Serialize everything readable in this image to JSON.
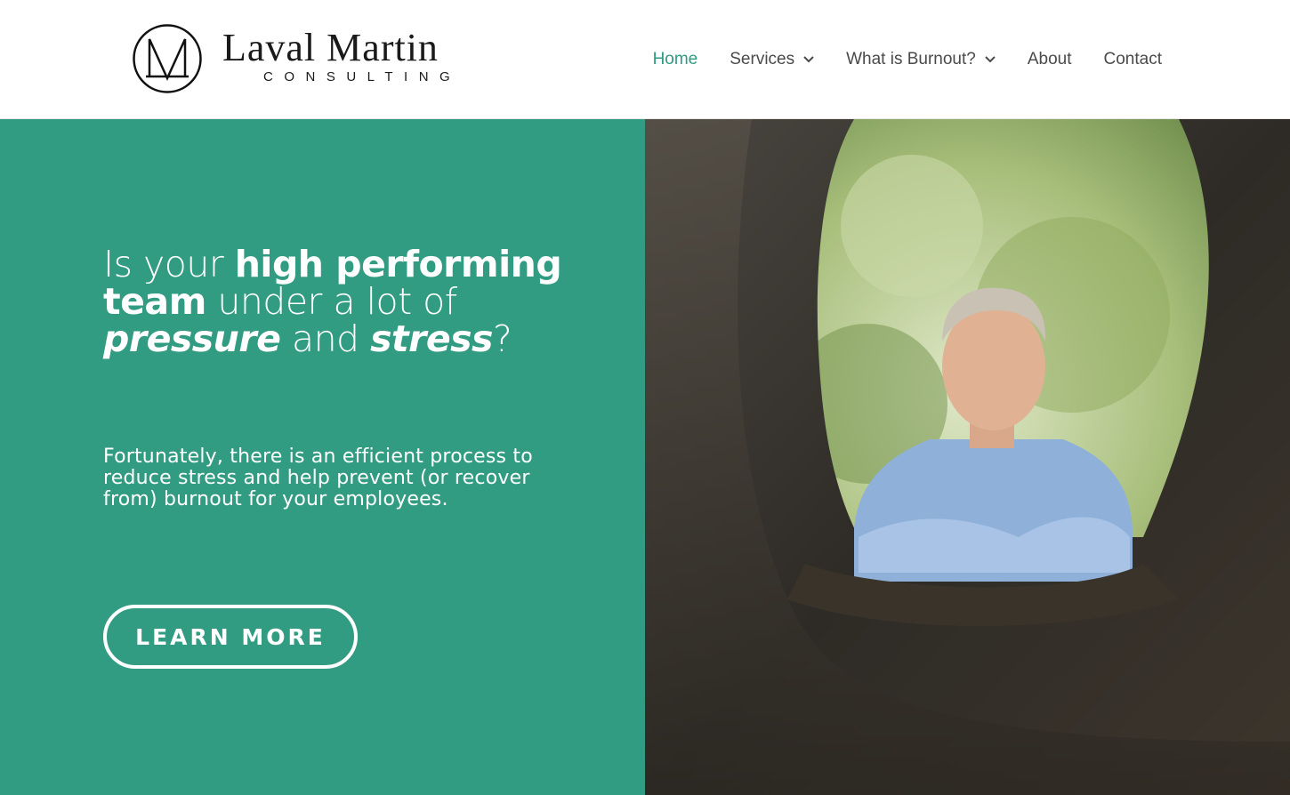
{
  "brand": {
    "name": "Laval Martin",
    "subtitle": "CONSULTING",
    "monogram": "M"
  },
  "nav": {
    "items": [
      {
        "label": "Home",
        "active": true,
        "has_dropdown": false
      },
      {
        "label": "Services",
        "active": false,
        "has_dropdown": true
      },
      {
        "label": "What is Burnout?",
        "active": false,
        "has_dropdown": true
      },
      {
        "label": "About",
        "active": false,
        "has_dropdown": false
      },
      {
        "label": "Contact",
        "active": false,
        "has_dropdown": false
      }
    ]
  },
  "hero": {
    "headline": {
      "part1": "Is your ",
      "part2": "high performing team",
      "part3": " under a lot of ",
      "part4": "pressure",
      "part5": " and ",
      "part6": "stress",
      "part7": "?"
    },
    "subtext": "Fortunately, there is an efficient process to reduce stress and help prevent (or recover from) burnout for your employees.",
    "cta_label": "LEARN MORE"
  },
  "colors": {
    "accent": "#329c83",
    "nav_active": "#2e9b82",
    "nav_text": "#4a4a4a"
  },
  "icons": {
    "logo": "monogram-circle-icon",
    "dropdown": "chevron-down-icon"
  }
}
